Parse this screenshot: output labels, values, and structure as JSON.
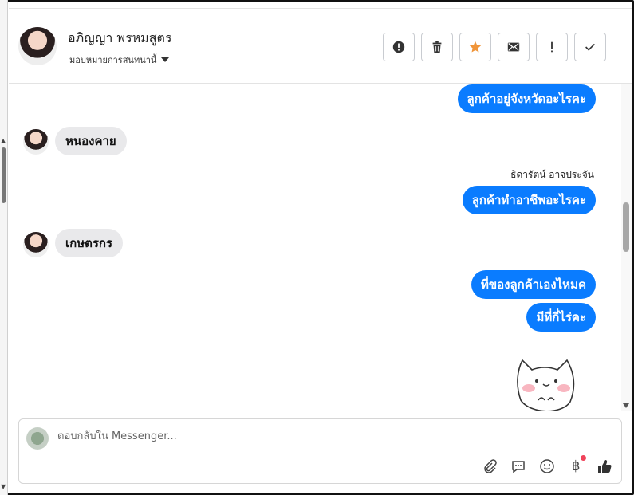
{
  "header": {
    "name": "อภิญญา พรหมสูตร",
    "assign_label": "มอบหมายการสนทนานี้",
    "actions": [
      {
        "icon": "alert-circle-icon"
      },
      {
        "icon": "trash-icon"
      },
      {
        "icon": "star-icon",
        "color": "#f0953a"
      },
      {
        "icon": "mail-icon"
      },
      {
        "icon": "exclamation-icon"
      },
      {
        "icon": "check-icon"
      }
    ]
  },
  "messages": [
    {
      "dir": "out",
      "text": "ลูกค้าอยู่จังหวัดอะไรคะ"
    },
    {
      "dir": "in",
      "text": "หนองคาย"
    },
    {
      "dir": "meta",
      "text": "ธิดารัตน์ อาจประจัน"
    },
    {
      "dir": "out",
      "text": "ลูกค้าทำอาชีพอะไรคะ"
    },
    {
      "dir": "in",
      "text": "เกษตรกร"
    },
    {
      "dir": "out",
      "text": "ที่ของลูกค้าเองไหมค"
    },
    {
      "dir": "out",
      "text": "มีที่กี่ไร่คะ"
    },
    {
      "dir": "sticker",
      "icon": "cat-sticker-icon"
    }
  ],
  "composer": {
    "placeholder": "ตอบกลับใน Messenger...",
    "tools": [
      "paperclip-icon",
      "speech-bubble-icon",
      "smiley-icon",
      "baht-icon",
      "thumbs-up-icon"
    ]
  },
  "colors": {
    "outgoing_bubble": "#0a7cff",
    "incoming_bubble": "#e9e9eb",
    "star": "#f0953a",
    "badge_dot": "#f0435a"
  }
}
